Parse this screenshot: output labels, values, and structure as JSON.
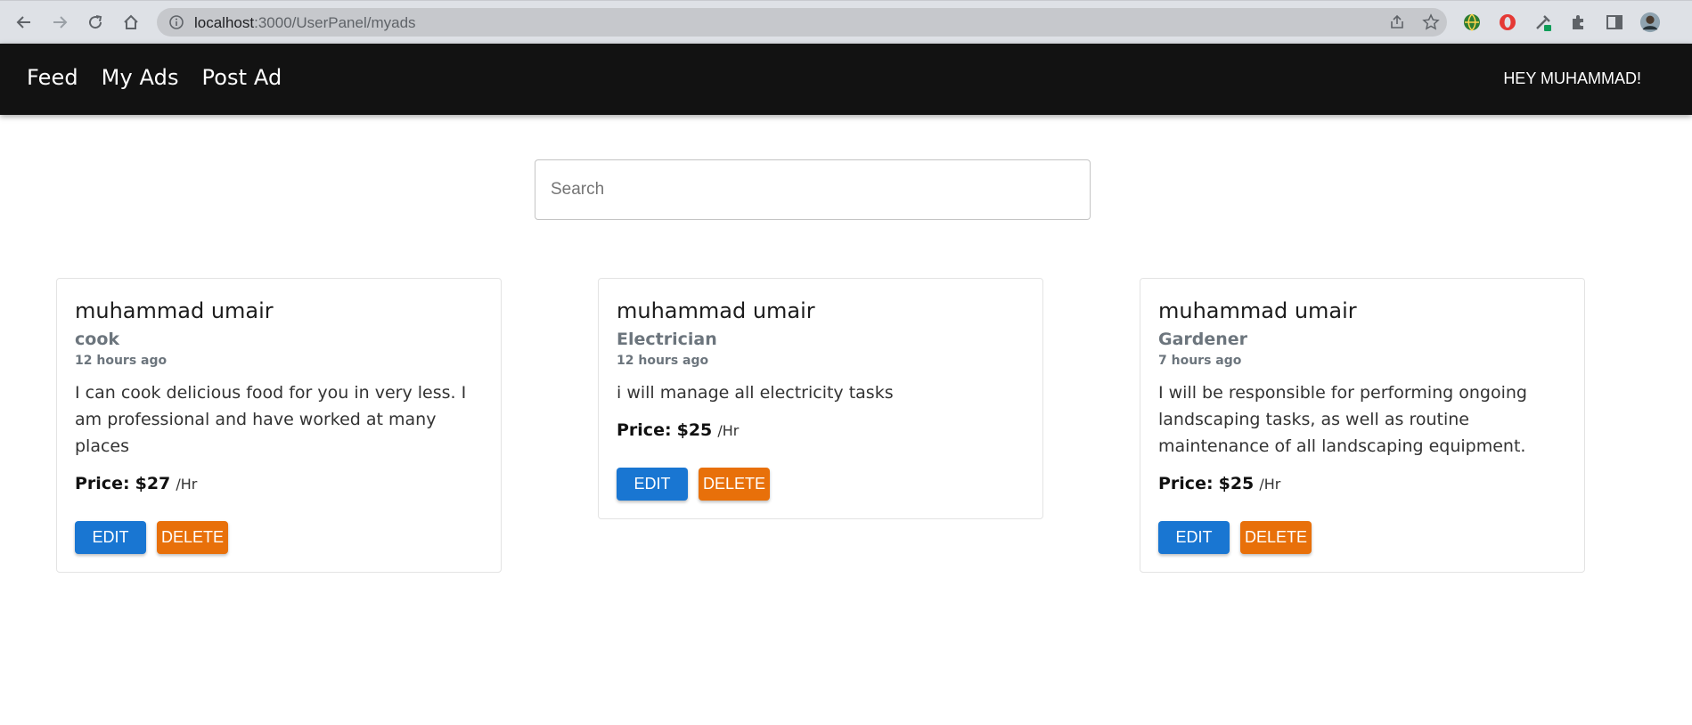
{
  "browser": {
    "url_host": "localhost",
    "url_path": ":3000/UserPanel/myads"
  },
  "header": {
    "nav": [
      "Feed",
      "My Ads",
      "Post Ad"
    ],
    "greeting": "HEY MUHAMMAD!"
  },
  "search": {
    "placeholder": "Search",
    "value": ""
  },
  "colors": {
    "header_bg": "#121212",
    "edit_button": "#1976d2",
    "delete_button": "#e8700a"
  },
  "ads": [
    {
      "name": "muhammad umair",
      "profession": "cook",
      "time": "12 hours ago",
      "description": "I can cook delicious food for you in very less. I am professional and have worked at many places",
      "price_label": "Price:",
      "price": "$27",
      "unit": "/Hr",
      "edit_label": "EDIT",
      "delete_label": "DELETE"
    },
    {
      "name": "muhammad umair",
      "profession": "Electrician",
      "time": "12 hours ago",
      "description": "i will manage all electricity tasks",
      "price_label": "Price:",
      "price": "$25",
      "unit": "/Hr",
      "edit_label": "EDIT",
      "delete_label": "DELETE"
    },
    {
      "name": "muhammad umair",
      "profession": "Gardener",
      "time": "7 hours ago",
      "description": "I will be responsible for performing ongoing landscaping tasks, as well as routine maintenance of all landscaping equipment.",
      "price_label": "Price:",
      "price": "$25",
      "unit": "/Hr",
      "edit_label": "EDIT",
      "delete_label": "DELETE"
    }
  ]
}
